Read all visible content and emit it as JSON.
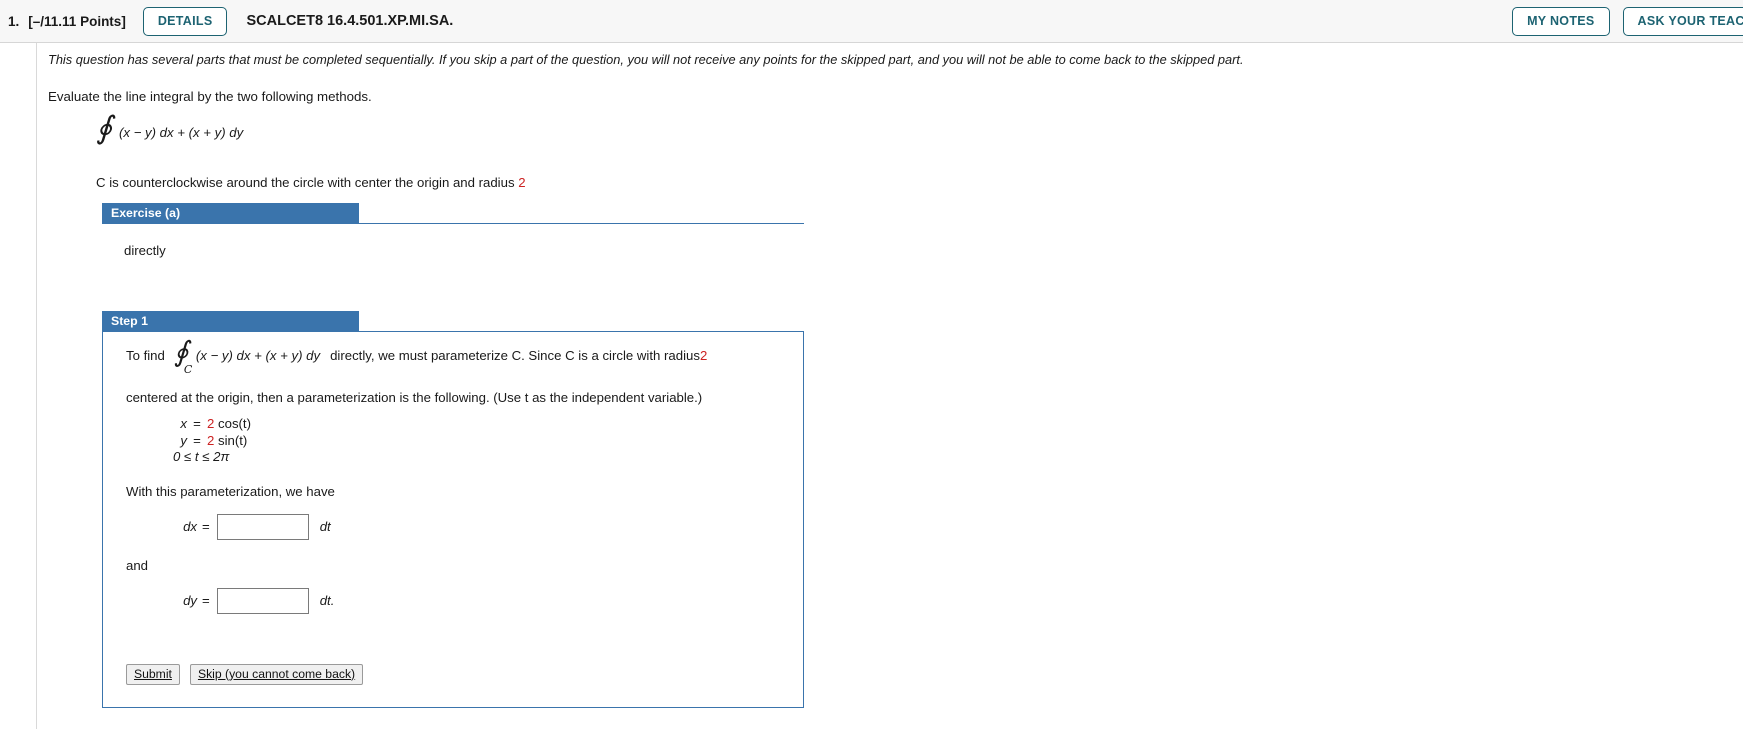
{
  "header": {
    "question_number": "1.",
    "points": "[–/11.11 Points]",
    "details_label": "DETAILS",
    "question_id": "SCALCET8 16.4.501.XP.MI.SA.",
    "my_notes_label": "MY NOTES",
    "ask_your_teacher_label": "ASK YOUR TEACHER",
    "accent_color": "#1d6372",
    "banner_color": "#3a74ac"
  },
  "body": {
    "warning": "This question has several parts that must be completed sequentially. If you skip a part of the question, you will not receive any points for the skipped part, and you will not be able to come back to the skipped part.",
    "prompt": "Evaluate the line integral by the two following methods.",
    "integral_symbol": "∮",
    "integral_expression": "(x − y) dx + (x + y) dy",
    "curve_description_pre": "C is counterclockwise around the circle with center the origin and radius ",
    "curve_radius": "2"
  },
  "exercise": {
    "banner_label": "Exercise (a)",
    "content": "directly"
  },
  "step": {
    "banner_label": "Step 1",
    "line1_pre": "To find",
    "integral_symbol": "∮",
    "integral_subscript": "C",
    "line1_expr": "(x − y) dx + (x + y) dy",
    "line1_post_pre": "directly, we must parameterize C. Since C is a circle with radius ",
    "line1_radius": "2",
    "line2": "centered at the origin, then a parameterization is the following. (Use t as the independent variable.)",
    "equations": [
      {
        "lhs": "x",
        "sign": "=",
        "coefficient": "2",
        "rhs": "cos(t)"
      },
      {
        "lhs": "y",
        "sign": "=",
        "coefficient": "2",
        "rhs": "sin(t)"
      }
    ],
    "range": "0 ≤ t ≤ 2π",
    "with_parameterization": "With this parameterization, we have",
    "dx_label": "dx",
    "dx_equals": "=",
    "dx_value": "",
    "dx_unit": "dt",
    "and_label": "and",
    "dy_label": "dy",
    "dy_equals": "=",
    "dy_value": "",
    "dy_unit": "dt.",
    "submit_label": "Submit",
    "skip_label": "Skip (you cannot come back)"
  }
}
